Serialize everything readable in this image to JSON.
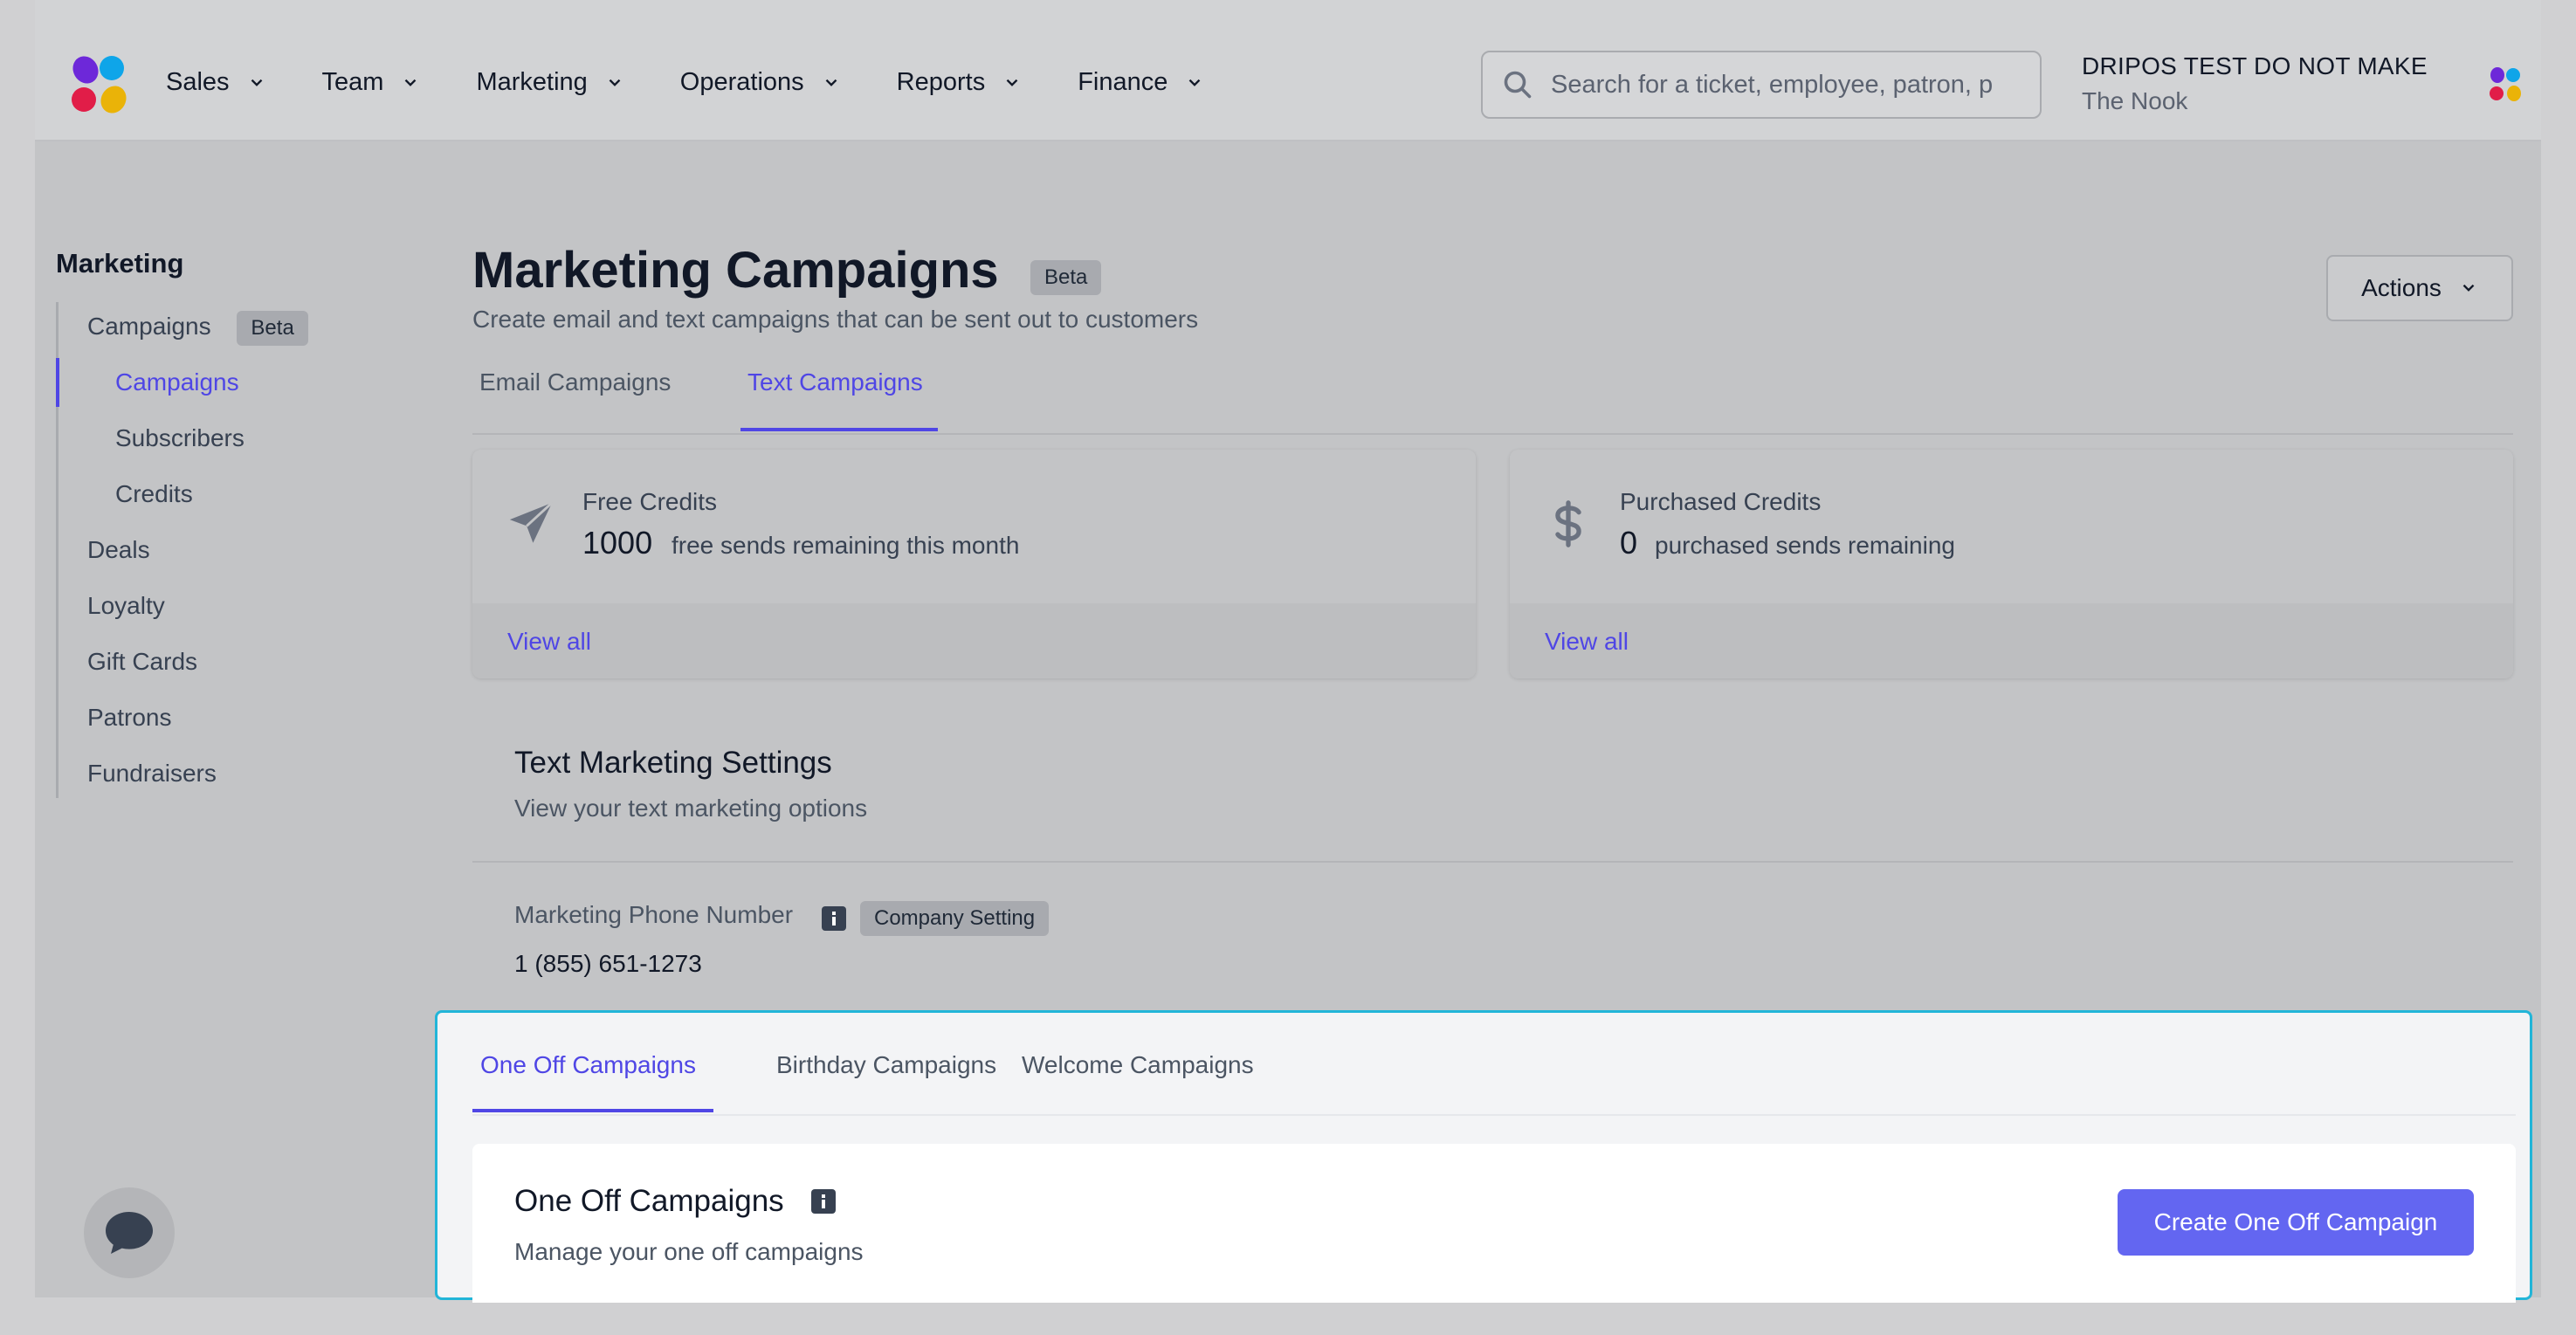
{
  "nav": {
    "items": [
      {
        "label": "Sales"
      },
      {
        "label": "Team"
      },
      {
        "label": "Marketing"
      },
      {
        "label": "Operations"
      },
      {
        "label": "Reports"
      },
      {
        "label": "Finance"
      }
    ]
  },
  "search": {
    "placeholder": "Search for a ticket, employee, patron, p"
  },
  "company": {
    "name": "DRIPOS TEST DO NOT MAKE",
    "location": "The Nook"
  },
  "sidebar": {
    "title": "Marketing",
    "items": [
      {
        "label": "Campaigns",
        "badge": "Beta"
      },
      {
        "label": "Campaigns"
      },
      {
        "label": "Subscribers"
      },
      {
        "label": "Credits"
      },
      {
        "label": "Deals"
      },
      {
        "label": "Loyalty"
      },
      {
        "label": "Gift Cards"
      },
      {
        "label": "Patrons"
      },
      {
        "label": "Fundraisers"
      }
    ]
  },
  "header": {
    "title": "Marketing Campaigns",
    "badge": "Beta",
    "subtitle": "Create email and text campaigns that can be sent out to customers",
    "actions_label": "Actions"
  },
  "tabs": [
    {
      "label": "Email Campaigns"
    },
    {
      "label": "Text Campaigns"
    }
  ],
  "credits": [
    {
      "label": "Free Credits",
      "value": "1000",
      "description": "free sends remaining this month",
      "link": "View all",
      "icon": "paper-plane-icon"
    },
    {
      "label": "Purchased Credits",
      "value": "0",
      "description": "purchased sends remaining",
      "link": "View all",
      "icon": "dollar-icon"
    }
  ],
  "settings": {
    "title": "Text Marketing Settings",
    "subtitle": "View your text marketing options",
    "field_label": "Marketing Phone Number",
    "field_badge": "Company Setting",
    "field_value": "1 (855) 651-1273"
  },
  "sub_tabs": [
    {
      "label": "One Off Campaigns"
    },
    {
      "label": "Birthday Campaigns"
    },
    {
      "label": "Welcome Campaigns"
    }
  ],
  "one_off": {
    "title": "One Off Campaigns",
    "subtitle": "Manage your one off campaigns",
    "button": "Create One Off Campaign"
  },
  "colors": {
    "accent": "#4f46e5",
    "button": "#6366f1",
    "highlight": "#22b5d8"
  }
}
